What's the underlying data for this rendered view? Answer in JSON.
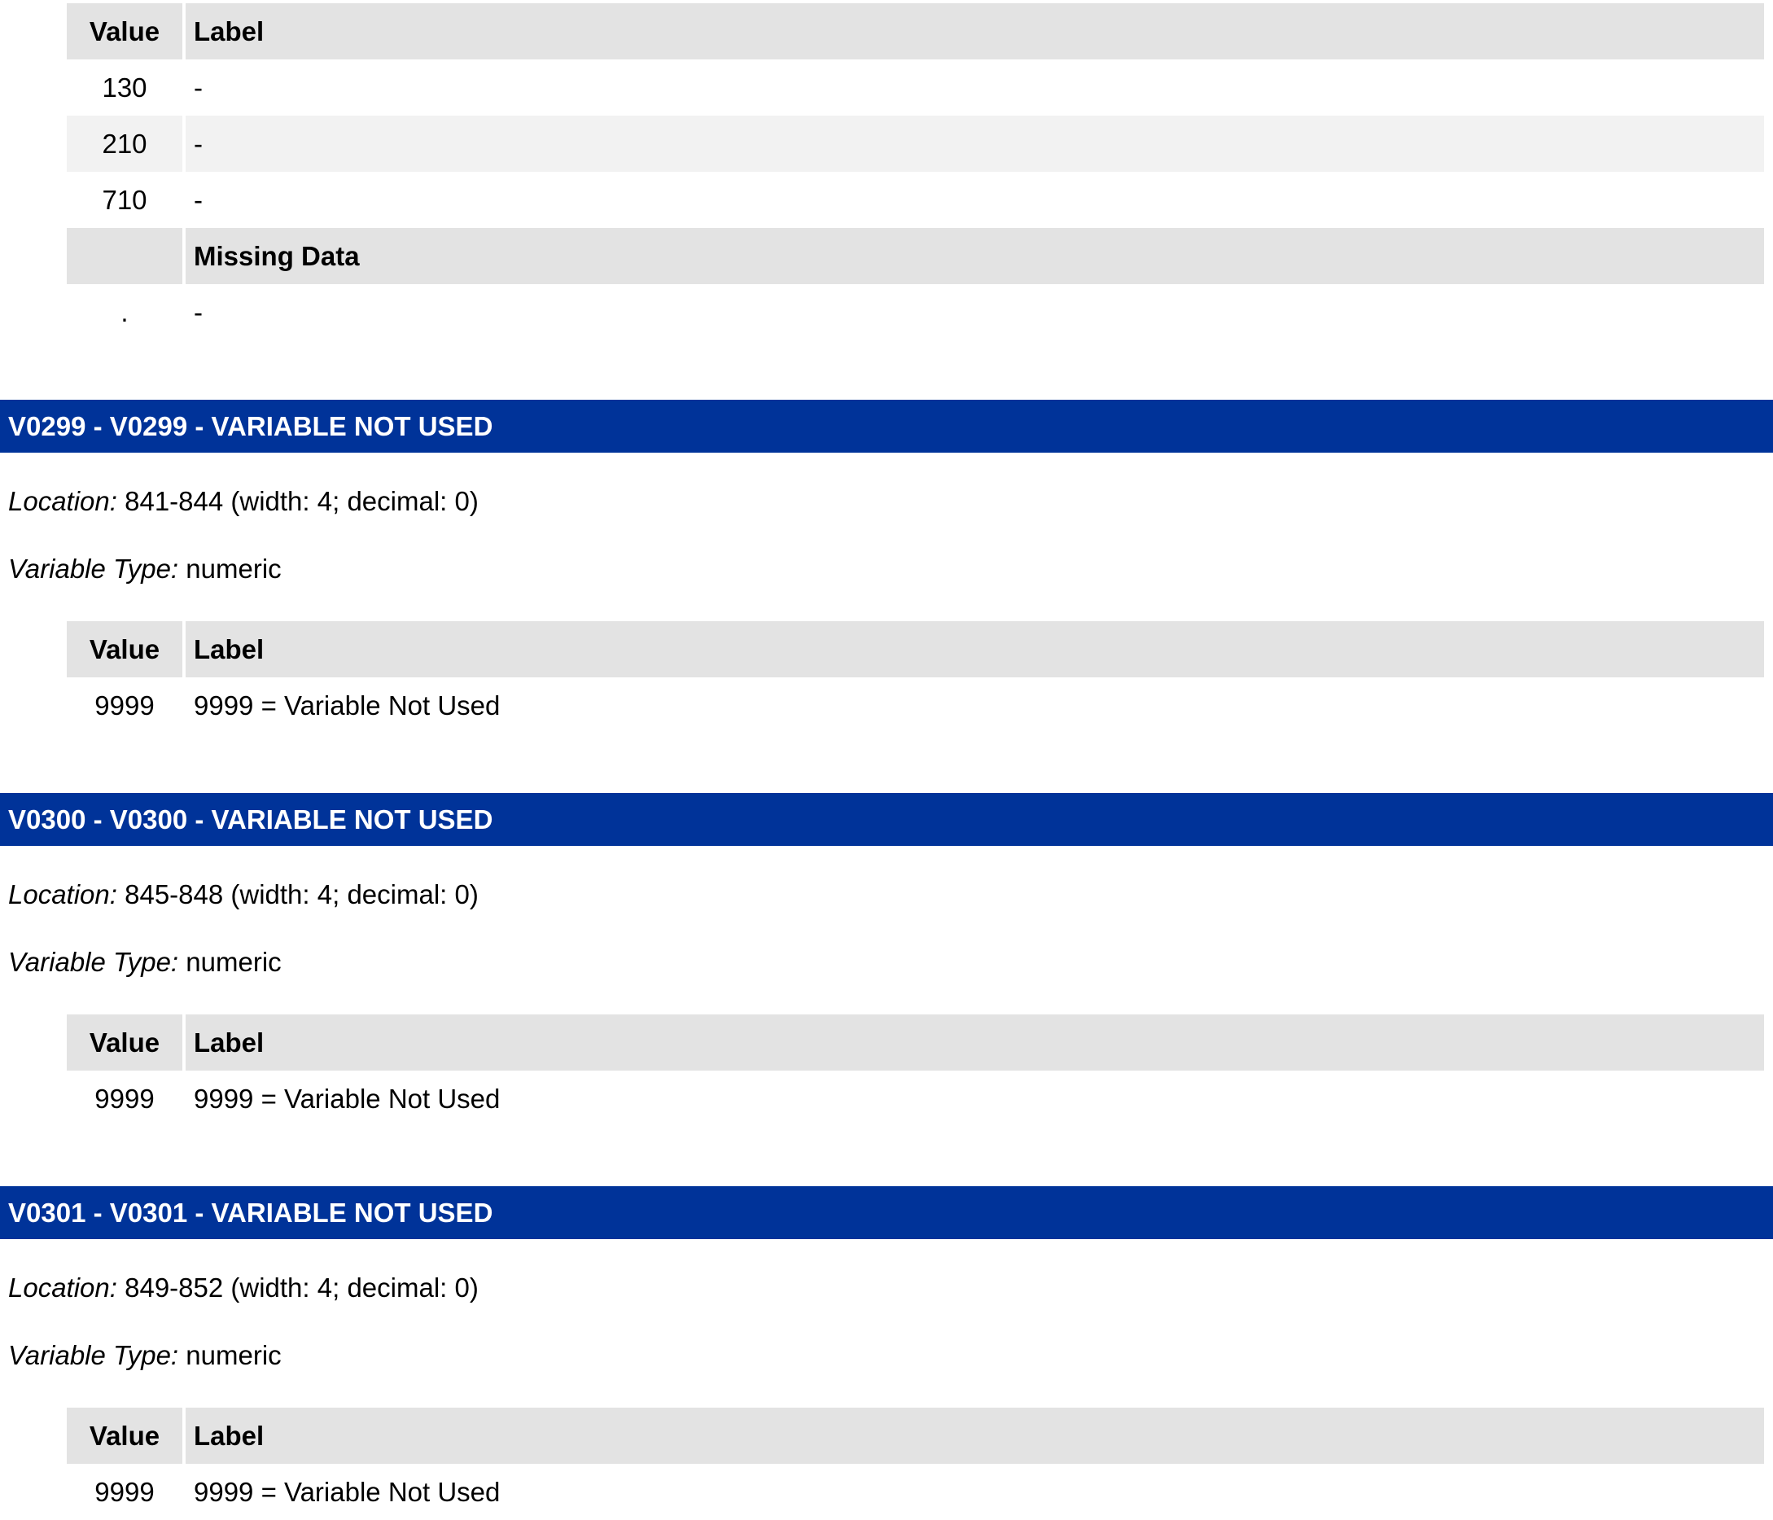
{
  "top_table": {
    "header": {
      "value": "Value",
      "label": "Label"
    },
    "rows": [
      {
        "value": "130",
        "label": "-"
      },
      {
        "value": "210",
        "label": "-"
      },
      {
        "value": "710",
        "label": "-"
      }
    ],
    "missing_header": {
      "value": "",
      "label": "Missing Data"
    },
    "missing_rows": [
      {
        "value": ".",
        "label": "-"
      }
    ]
  },
  "sections": [
    {
      "title": "V0299 - V0299 - VARIABLE NOT USED",
      "location_label": "Location:",
      "location_value": "841-844 (width: 4; decimal: 0)",
      "type_label": "Variable Type:",
      "type_value": "numeric",
      "header": {
        "value": "Value",
        "label": "Label"
      },
      "rows": [
        {
          "value": "9999",
          "label": "9999 = Variable Not Used"
        }
      ]
    },
    {
      "title": "V0300 - V0300 - VARIABLE NOT USED",
      "location_label": "Location:",
      "location_value": "845-848 (width: 4; decimal: 0)",
      "type_label": "Variable Type:",
      "type_value": "numeric",
      "header": {
        "value": "Value",
        "label": "Label"
      },
      "rows": [
        {
          "value": "9999",
          "label": "9999 = Variable Not Used"
        }
      ]
    },
    {
      "title": "V0301 - V0301 - VARIABLE NOT USED",
      "location_label": "Location:",
      "location_value": "849-852 (width: 4; decimal: 0)",
      "type_label": "Variable Type:",
      "type_value": "numeric",
      "header": {
        "value": "Value",
        "label": "Label"
      },
      "rows": [
        {
          "value": "9999",
          "label": "9999 = Variable Not Used"
        }
      ]
    }
  ],
  "colors": {
    "section_bar": "#003399",
    "table_header": "#e3e3e3",
    "alt_row": "#f2f2f2"
  }
}
